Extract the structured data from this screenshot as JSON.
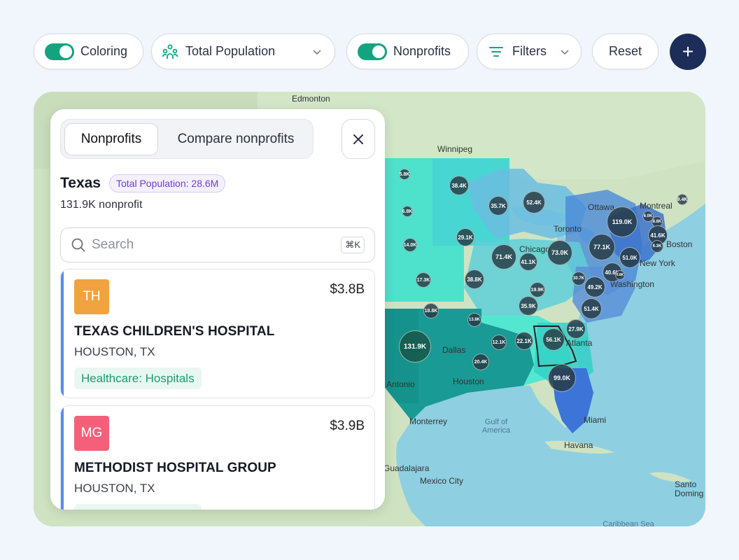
{
  "toolbar": {
    "coloring_label": "Coloring",
    "metric_label": "Total Population",
    "nonprofits_label": "Nonprofits",
    "filters_label": "Filters",
    "reset_label": "Reset",
    "add_label": "+"
  },
  "map": {
    "cities": {
      "edmonton": "Edmonton",
      "winnipeg": "Winnipeg",
      "ottawa": "Ottawa",
      "montreal": "Montreal",
      "toronto": "Toronto",
      "chicago": "Chicago",
      "boston": "Boston",
      "new_york": "New York",
      "washington": "Washington",
      "dallas": "Dallas",
      "san_antonio": "Antonio",
      "houston": "Houston",
      "atlanta": "Atlanta",
      "miami": "Miami",
      "havana": "Havana",
      "monterrey": "Monterrey",
      "guadalajara": "Guadalajara",
      "mexico_city": "Mexico City",
      "santo_domingo_1": "Santo",
      "santo_domingo_2": "Doming"
    },
    "seas": {
      "gulf_1": "Gulf of",
      "gulf_2": "America",
      "caribbean": "Caribbean Sea"
    },
    "bubbles": {
      "b1": "5.8K",
      "b2": "38.4K",
      "b3": "35.7K",
      "b4": "52.4K",
      "b5": "9.4K",
      "b6": "6.8K",
      "b7": "119.0K",
      "b8": "6.0K",
      "b9": "8.6K",
      "b10": "41.6K",
      "b11": "6.3K",
      "b12": "14.0K",
      "b13": "29.1K",
      "b14": "71.4K",
      "b15": "73.0K",
      "b16": "77.1K",
      "b17": "41.1K",
      "b18": "51.0K",
      "b19": "17.3K",
      "b20": "38.8K",
      "b21": "19.9K",
      "b22": "30.7K",
      "b23": "40.6K",
      "b24": "49.2K",
      "b25": "18.8K",
      "b26": "35.9K",
      "b27": "51.4K",
      "b28": "13.8K",
      "b29": "27.9K",
      "b30": "131.9K",
      "b31": "12.1K",
      "b32": "22.1K",
      "b33": "56.1K",
      "b34": "20.4K",
      "b35": "99.0K",
      "b36": "6.8K"
    }
  },
  "panel": {
    "tab_nonprofits": "Nonprofits",
    "tab_compare": "Compare nonprofits",
    "state_name": "Texas",
    "population_badge": "Total Population: 28.6M",
    "nonprofit_count": "131.9K nonprofit",
    "search_placeholder": "Search",
    "search_shortcut": "⌘K",
    "cards": [
      {
        "initials": "TH",
        "avatar_color": "#f0a33e",
        "amount": "$3.8B",
        "name": "TEXAS CHILDREN'S HOSPITAL",
        "location": "HOUSTON, TX",
        "category": "Healthcare: Hospitals"
      },
      {
        "initials": "MG",
        "avatar_color": "#f4607a",
        "amount": "$3.9B",
        "name": "METHODIST HOSPITAL GROUP",
        "location": "HOUSTON, TX",
        "category": "Healthcare: Hospitals"
      }
    ]
  },
  "colors": {
    "accent_green": "#14a37f",
    "primary_navy": "#1c2d5a",
    "card_stripe": "#5a8bf0"
  }
}
